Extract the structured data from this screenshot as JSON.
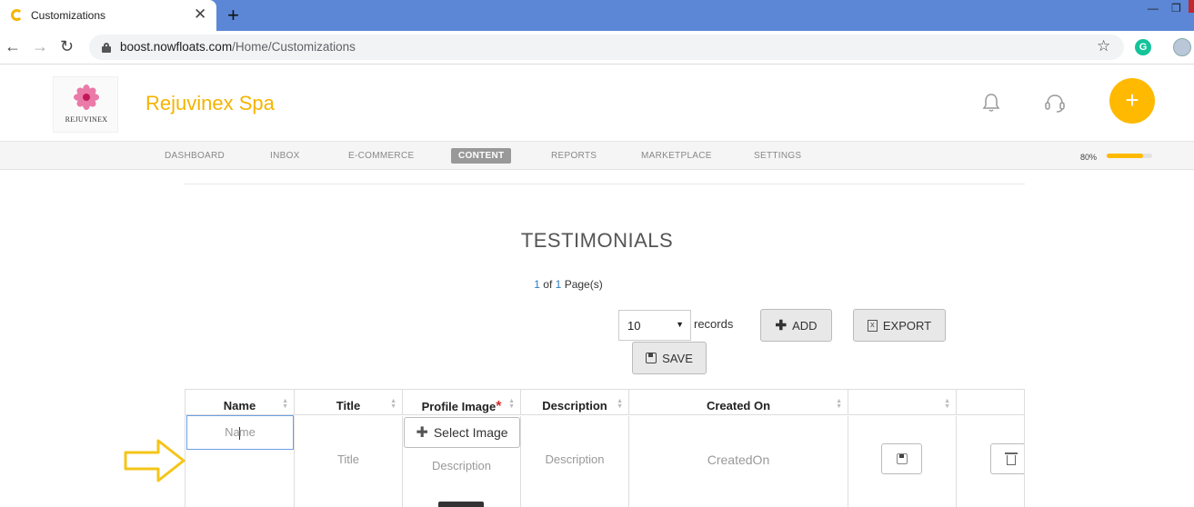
{
  "browser": {
    "tab_title": "Customizations",
    "tab_close": "✕",
    "new_tab": "+",
    "url_host": "boost.nowfloats.com",
    "url_path": "/Home/Customizations",
    "minimize": "—",
    "restore": "❐",
    "back": "←",
    "forward": "→",
    "reload": "↻",
    "bookmark": "☆",
    "extension_letter": "G"
  },
  "header": {
    "logo_text": "REJUVINEX",
    "brand": "Rejuvinex Spa",
    "fab_label": "+",
    "brand_color": "#f5b400",
    "accent_color": "#ffb900"
  },
  "nav": {
    "items": [
      {
        "label": "DASHBOARD"
      },
      {
        "label": "INBOX"
      },
      {
        "label": "E-COMMERCE"
      },
      {
        "label": "CONTENT",
        "active": true
      },
      {
        "label": "REPORTS"
      },
      {
        "label": "MARKETPLACE"
      },
      {
        "label": "SETTINGS"
      }
    ],
    "progress_label": "80%",
    "progress_value": 80
  },
  "main": {
    "title": "TESTIMONIALS",
    "pager": {
      "current": "1",
      "of": "of",
      "total": "1",
      "suffix": "Page(s)"
    },
    "records_select": "10",
    "records_label": "records",
    "add_label": "ADD",
    "export_label": "EXPORT",
    "save_label": "SAVE"
  },
  "table": {
    "columns": [
      {
        "label": "Name"
      },
      {
        "label": "Title"
      },
      {
        "label": "Profile Image",
        "required": "*"
      },
      {
        "label": "Description"
      },
      {
        "label": "Created On"
      },
      {
        "label": ""
      },
      {
        "label": ""
      }
    ],
    "row": {
      "name_placeholder_a": "Na",
      "name_placeholder_b": "me",
      "title_placeholder": "Title",
      "select_image_label": "Select Image",
      "image_description": "Description",
      "description_placeholder": "Description",
      "created_placeholder": "CreatedOn"
    }
  }
}
